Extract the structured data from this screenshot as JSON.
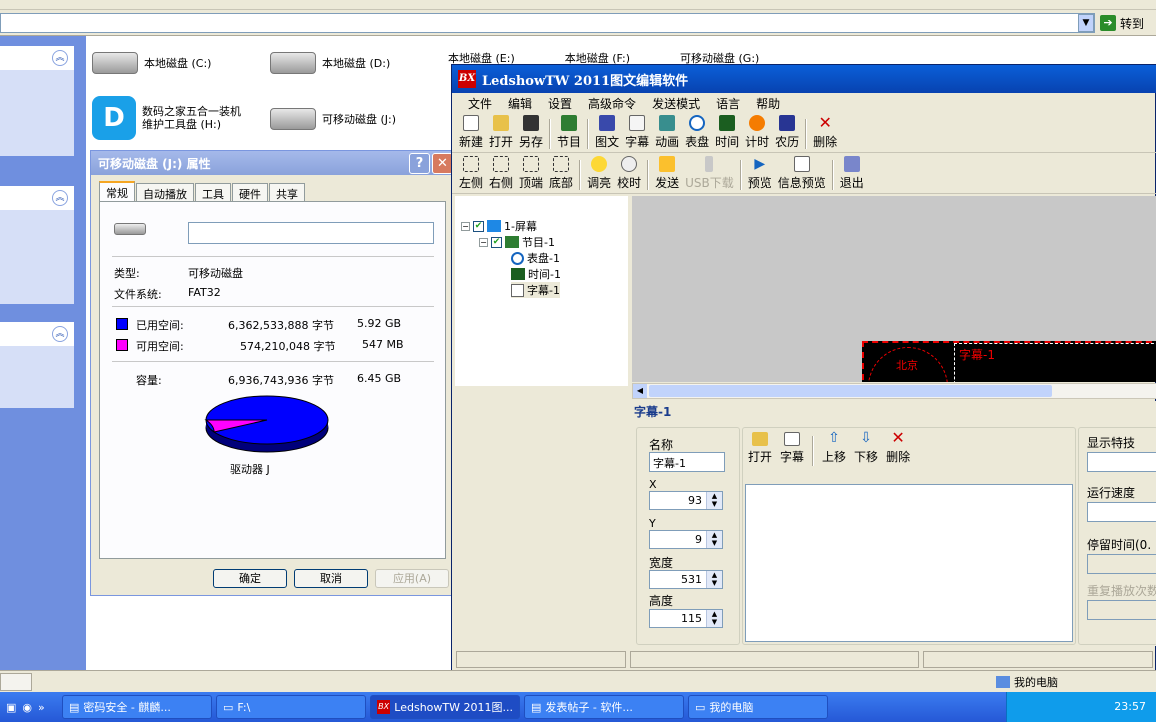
{
  "address_bar": {
    "go_label": "转到"
  },
  "drives": {
    "c": "本地磁盘 (C:)",
    "d": "本地磁盘 (D:)",
    "e_partial": "本地磁盘 (E:)",
    "f_partial": "本地磁盘 (F:)",
    "g_partial": "可移动磁盘 (G:)",
    "h_line1": "数码之家五合一装机",
    "h_line2": "维护工具盘 (H:)",
    "j": "可移动磁盘 (J:)"
  },
  "properties_dialog": {
    "title": "可移动磁盘 (J:) 属性",
    "tabs": [
      "常规",
      "自动播放",
      "工具",
      "硬件",
      "共享"
    ],
    "name_value": "",
    "type_label": "类型:",
    "type_value": "可移动磁盘",
    "fs_label": "文件系统:",
    "fs_value": "FAT32",
    "used_label": "已用空间:",
    "used_bytes": "6,362,533,888 字节",
    "used_size": "5.92 GB",
    "free_label": "可用空间:",
    "free_bytes": "574,210,048 字节",
    "free_size": "547 MB",
    "capacity_label": "容量:",
    "capacity_bytes": "6,936,743,936 字节",
    "capacity_size": "6.45 GB",
    "drive_label": "驱动器 J",
    "used_color": "#0000ff",
    "free_color": "#ff00ff",
    "used_fraction": 0.917,
    "buttons": {
      "ok": "确定",
      "cancel": "取消",
      "apply": "应用(A)"
    }
  },
  "app": {
    "title": "LedshowTW 2011图文编辑软件",
    "menu": [
      "文件",
      "编辑",
      "设置",
      "高级命令",
      "发送模式",
      "语言",
      "帮助"
    ],
    "toolbar1": [
      "新建",
      "打开",
      "另存",
      "节目",
      "图文",
      "字幕",
      "动画",
      "表盘",
      "时间",
      "计时",
      "农历",
      "删除"
    ],
    "toolbar2": [
      "左侧",
      "右侧",
      "顶端",
      "底部",
      "调亮",
      "校时",
      "发送",
      "USB下载",
      "预览",
      "信息预览",
      "退出"
    ],
    "tree": {
      "screen": "1-屏幕",
      "program": "节目-1",
      "dial": "表盘-1",
      "time": "时间-1",
      "subtitle": "字幕-1"
    },
    "preview_label": "字幕-1",
    "preview_dial_text": "北京",
    "section_title": "字幕-1",
    "props": {
      "name_label": "名称",
      "name_value": "字幕-1",
      "x_label": "X",
      "x_value": "93",
      "y_label": "Y",
      "y_value": "9",
      "width_label": "宽度",
      "width_value": "531",
      "height_label": "高度",
      "height_value": "115"
    },
    "content_toolbar": [
      "打开",
      "字幕",
      "上移",
      "下移",
      "删除"
    ],
    "right_props": {
      "effect": "显示特技",
      "speed": "运行速度",
      "stay": "停留时间(0.",
      "repeat": "重复播放次数"
    }
  },
  "taskbar": {
    "tasks": [
      "密码安全 - 麒麟...",
      "F:\\",
      "LedshowTW 2011图...",
      "发表帖子 - 软件...",
      "我的电脑"
    ],
    "mycomputer": "我的电脑",
    "clock": "23:57"
  }
}
